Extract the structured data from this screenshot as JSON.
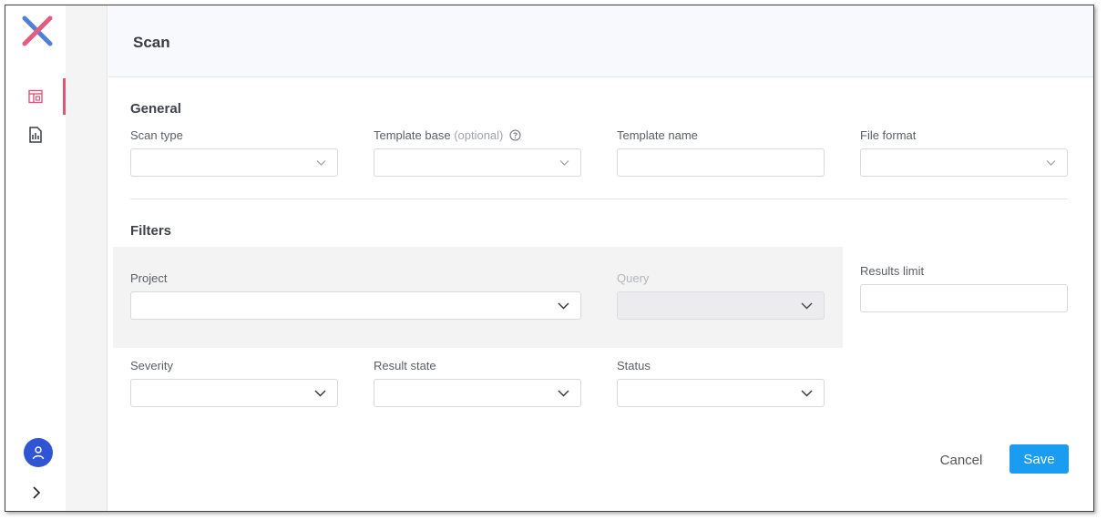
{
  "header": {
    "title": "Scan"
  },
  "general": {
    "title": "General",
    "scan_type": {
      "label": "Scan type",
      "value": ""
    },
    "template_base": {
      "label": "Template base",
      "optional": "(optional)",
      "value": ""
    },
    "template_name": {
      "label": "Template name",
      "value": ""
    },
    "file_format": {
      "label": "File format",
      "value": ""
    }
  },
  "filters": {
    "title": "Filters",
    "project": {
      "label": "Project",
      "value": ""
    },
    "query": {
      "label": "Query",
      "value": "",
      "disabled": true
    },
    "results_limit": {
      "label": "Results limit",
      "value": ""
    },
    "severity": {
      "label": "Severity",
      "value": ""
    },
    "result_state": {
      "label": "Result state",
      "value": ""
    },
    "status": {
      "label": "Status",
      "value": ""
    }
  },
  "actions": {
    "cancel": "Cancel",
    "save": "Save"
  },
  "icons": {
    "logo": "x-logo-icon",
    "nav": [
      "dashboard-icon",
      "report-icon"
    ],
    "user": "user-icon",
    "expand": "chevron-right-icon",
    "help": "help-circle-icon"
  },
  "colors": {
    "accent": "#e0567a",
    "primary": "#1a9cf0",
    "avatar": "#2f55d4",
    "logo_pink": "#e45c7f",
    "logo_blue": "#4f7fd9"
  }
}
